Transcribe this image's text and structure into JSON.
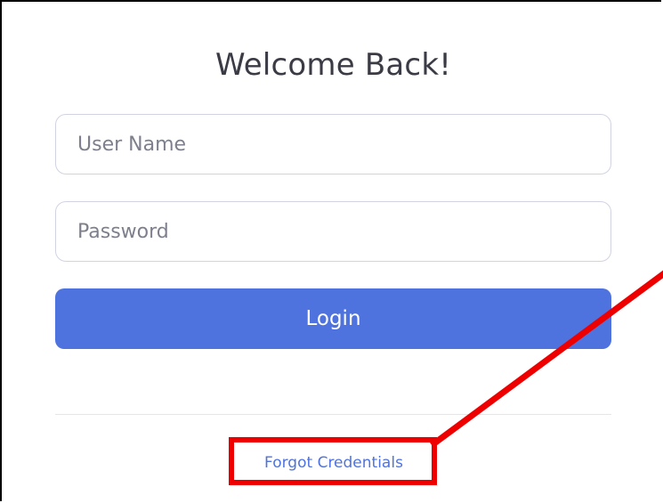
{
  "login_form": {
    "title": "Welcome Back!",
    "username_placeholder": "User Name",
    "password_placeholder": "Password",
    "login_label": "Login",
    "forgot_label": "Forgot Credentials"
  },
  "annotation": {
    "color": "#ee0000",
    "target": "forgot-credentials-link"
  },
  "colors": {
    "primary": "#4e73df",
    "border": "#d1d3e2",
    "text": "#3a3b45"
  }
}
